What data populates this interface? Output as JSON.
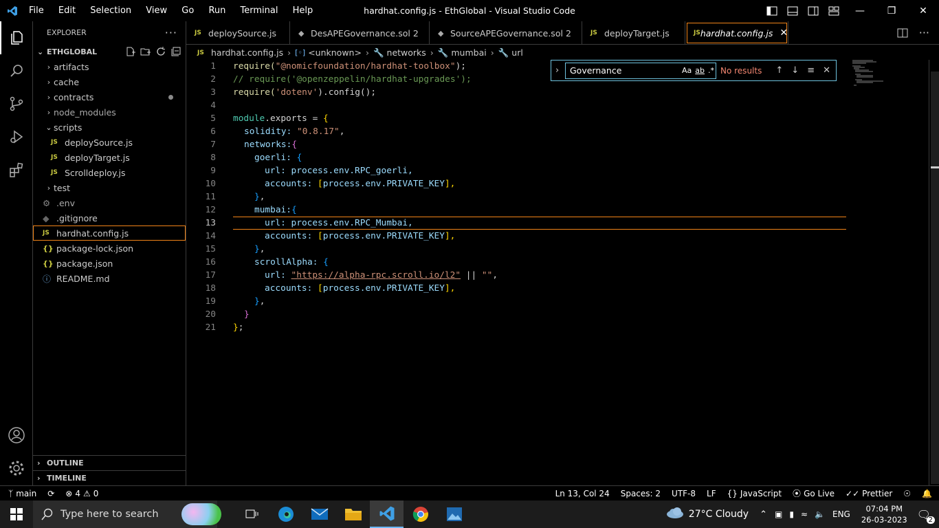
{
  "titlebar": {
    "menu": [
      "File",
      "Edit",
      "Selection",
      "View",
      "Go",
      "Run",
      "Terminal",
      "Help"
    ],
    "title": "hardhat.config.js - EthGlobal - Visual Studio Code"
  },
  "sidebar": {
    "header": "EXPLORER",
    "folder": "ETHGLOBAL",
    "items": [
      {
        "label": "artifacts",
        "type": "folder",
        "expanded": false
      },
      {
        "label": "cache",
        "type": "folder",
        "expanded": false
      },
      {
        "label": "contracts",
        "type": "folder",
        "expanded": false
      },
      {
        "label": "node_modules",
        "type": "folder",
        "expanded": false
      },
      {
        "label": "scripts",
        "type": "folder",
        "expanded": true
      },
      {
        "label": "deploySource.js",
        "type": "js"
      },
      {
        "label": "deployTarget.js",
        "type": "js"
      },
      {
        "label": "Scrolldeploy.js",
        "type": "js"
      },
      {
        "label": "test",
        "type": "folder",
        "expanded": false
      },
      {
        "label": ".env",
        "type": "env"
      },
      {
        "label": ".gitignore",
        "type": "git"
      },
      {
        "label": "hardhat.config.js",
        "type": "js"
      },
      {
        "label": "package-lock.json",
        "type": "json"
      },
      {
        "label": "package.json",
        "type": "json"
      },
      {
        "label": "README.md",
        "type": "info"
      }
    ],
    "outline": "OUTLINE",
    "timeline": "TIMELINE"
  },
  "tabs": [
    {
      "label": "deploySource.js",
      "icon": "JS",
      "badge": ""
    },
    {
      "label": "DesAPEGovernance.sol",
      "icon": "sol",
      "badge": "2"
    },
    {
      "label": "SourceAPEGovernance.sol",
      "icon": "sol",
      "badge": "2"
    },
    {
      "label": "deployTarget.js",
      "icon": "JS",
      "badge": ""
    },
    {
      "label": "hardhat.config.js",
      "icon": "JS",
      "badge": ""
    }
  ],
  "breadcrumb": [
    "hardhat.config.js",
    "<unknown>",
    "networks",
    "mumbai",
    "url"
  ],
  "find": {
    "value": "Governance",
    "result": "No results",
    "opt_case": "Aa",
    "opt_word": "ab",
    "opt_regex": ".*"
  },
  "code": {
    "line1_a": "require(",
    "line1_b": "\"@nomicfoundation/hardhat-toolbox\"",
    "line1_c": ");",
    "line2": "// require('@openzeppelin/hardhat-upgrades');",
    "line3_a": "require(",
    "line3_b": "'dotenv'",
    "line3_c": ").config();",
    "line5_a": "module",
    "line5_b": ".exports = ",
    "line5_c": "{",
    "line6_a": "solidity: ",
    "line6_b": "\"0.8.17\"",
    "line6_c": ",",
    "line7_a": "networks:",
    "line7_b": "{",
    "line8_a": "goerli: ",
    "line8_b": "{",
    "line9_a": "url: ",
    "line9_b": "process.env.RPC_goerli,",
    "line10_a": "accounts: ",
    "line10_b": "[",
    "line10_c": "process.env.PRIVATE_KEY",
    "line10_d": "],",
    "line11_a": "}",
    "line11_b": ",",
    "line12_a": "mumbai:",
    "line12_b": "{",
    "line13_a": "url: ",
    "line13_b": "process.env.RPC_Mumbai,",
    "line14_a": "accounts: ",
    "line14_b": "[",
    "line14_c": "process.env.PRIVATE_KEY",
    "line14_d": "],",
    "line15_a": "}",
    "line15_b": ",",
    "line16_a": "scrollAlpha: ",
    "line16_b": "{",
    "line17_a": "url: ",
    "line17_b": "\"https://alpha-rpc.scroll.io/l2\"",
    "line17_c": " || ",
    "line17_d": "\"\"",
    "line17_e": ",",
    "line18_a": "accounts: ",
    "line18_b": "[",
    "line18_c": "process.env.PRIVATE_KEY",
    "line18_d": "],",
    "line19_a": "}",
    "line19_b": ",",
    "line20": "}",
    "line21_a": "}",
    "line21_b": ";"
  },
  "line_numbers": [
    "1",
    "2",
    "3",
    "4",
    "5",
    "6",
    "7",
    "8",
    "9",
    "10",
    "11",
    "12",
    "13",
    "14",
    "15",
    "16",
    "17",
    "18",
    "19",
    "20",
    "21"
  ],
  "statusbar": {
    "branch": "main",
    "errors": "4",
    "warnings": "0",
    "position": "Ln 13, Col 24",
    "spaces": "Spaces: 2",
    "encoding": "UTF-8",
    "eol": "LF",
    "language": "JavaScript",
    "golive": "Go Live",
    "prettier": "Prettier"
  },
  "taskbar": {
    "search_placeholder": "Type here to search",
    "weather": "27°C  Cloudy",
    "lang": "ENG",
    "time": "07:04 PM",
    "date": "26-03-2023",
    "notifications": "2"
  },
  "colors": {
    "accent_border": "#f38518",
    "find_border": "#6fc3df",
    "no_results": "#f48771"
  }
}
